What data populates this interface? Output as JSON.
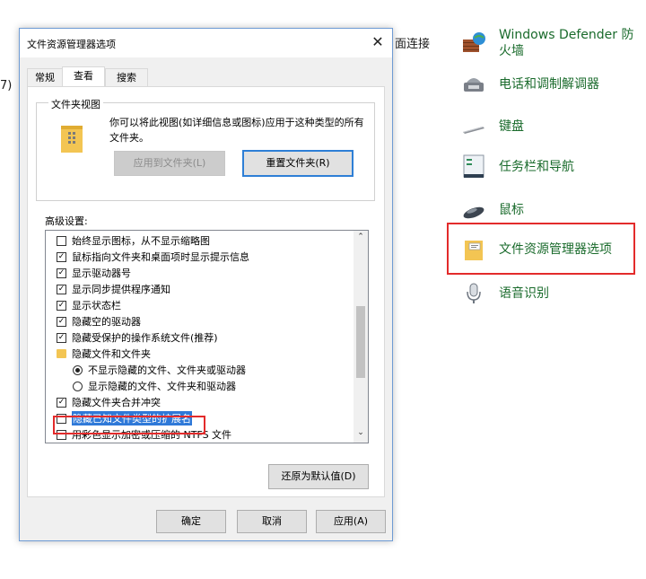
{
  "background": {
    "fragment_left": "7)",
    "fragment_mid": "面连接",
    "items": [
      {
        "label": "Windows Defender 防火墙",
        "icon": "firewall-icon"
      },
      {
        "label": "电话和调制解调器",
        "icon": "phone-modem-icon"
      },
      {
        "label": "键盘",
        "icon": "keyboard-icon"
      },
      {
        "label": "任务栏和导航",
        "icon": "taskbar-icon"
      },
      {
        "label": "鼠标",
        "icon": "mouse-icon"
      },
      {
        "label": "文件资源管理器选项",
        "icon": "folder-options-icon"
      },
      {
        "label": "语音识别",
        "icon": "microphone-icon"
      }
    ]
  },
  "dialog": {
    "title": "文件资源管理器选项",
    "tabs": [
      {
        "label": "常规",
        "active": false
      },
      {
        "label": "查看",
        "active": true
      },
      {
        "label": "搜索",
        "active": false
      }
    ],
    "folder_views": {
      "group_title": "文件夹视图",
      "description": "你可以将此视图(如详细信息或图标)应用于这种类型的所有文件夹。",
      "apply_button": "应用到文件夹(L)",
      "reset_button": "重置文件夹(R)"
    },
    "advanced_label": "高级设置:",
    "settings": [
      {
        "type": "checkbox",
        "checked": false,
        "label": "始终显示图标，从不显示缩略图",
        "indent": 0
      },
      {
        "type": "checkbox",
        "checked": true,
        "label": "鼠标指向文件夹和桌面项时显示提示信息",
        "indent": 0
      },
      {
        "type": "checkbox",
        "checked": true,
        "label": "显示驱动器号",
        "indent": 0
      },
      {
        "type": "checkbox",
        "checked": true,
        "label": "显示同步提供程序通知",
        "indent": 0
      },
      {
        "type": "checkbox",
        "checked": true,
        "label": "显示状态栏",
        "indent": 0
      },
      {
        "type": "checkbox",
        "checked": true,
        "label": "隐藏空的驱动器",
        "indent": 0
      },
      {
        "type": "checkbox",
        "checked": true,
        "label": "隐藏受保护的操作系统文件(推荐)",
        "indent": 0
      },
      {
        "type": "folder",
        "checked": false,
        "label": "隐藏文件和文件夹",
        "indent": 0
      },
      {
        "type": "radio",
        "checked": true,
        "label": "不显示隐藏的文件、文件夹或驱动器",
        "indent": 1
      },
      {
        "type": "radio",
        "checked": false,
        "label": "显示隐藏的文件、文件夹和驱动器",
        "indent": 1
      },
      {
        "type": "checkbox",
        "checked": true,
        "label": "隐藏文件夹合并冲突",
        "indent": 0
      },
      {
        "type": "checkbox",
        "checked": false,
        "label": "隐藏已知文件类型的扩展名",
        "indent": 0,
        "selected": true
      },
      {
        "type": "checkbox",
        "checked": false,
        "label": "用彩色显示加密或压缩的 NTFS 文件",
        "indent": 0
      }
    ],
    "restore_button": "还原为默认值(D)",
    "ok_button": "确定",
    "cancel_button": "取消",
    "apply_button": "应用(A)",
    "check_mark": "✓",
    "close_glyph": "✕",
    "scroll_up_glyph": "⌃",
    "scroll_down_glyph": "⌄"
  },
  "colors": {
    "highlight_border": "#e32b2b",
    "selection": "#2f79d8",
    "link_green": "#1a6b2c"
  }
}
